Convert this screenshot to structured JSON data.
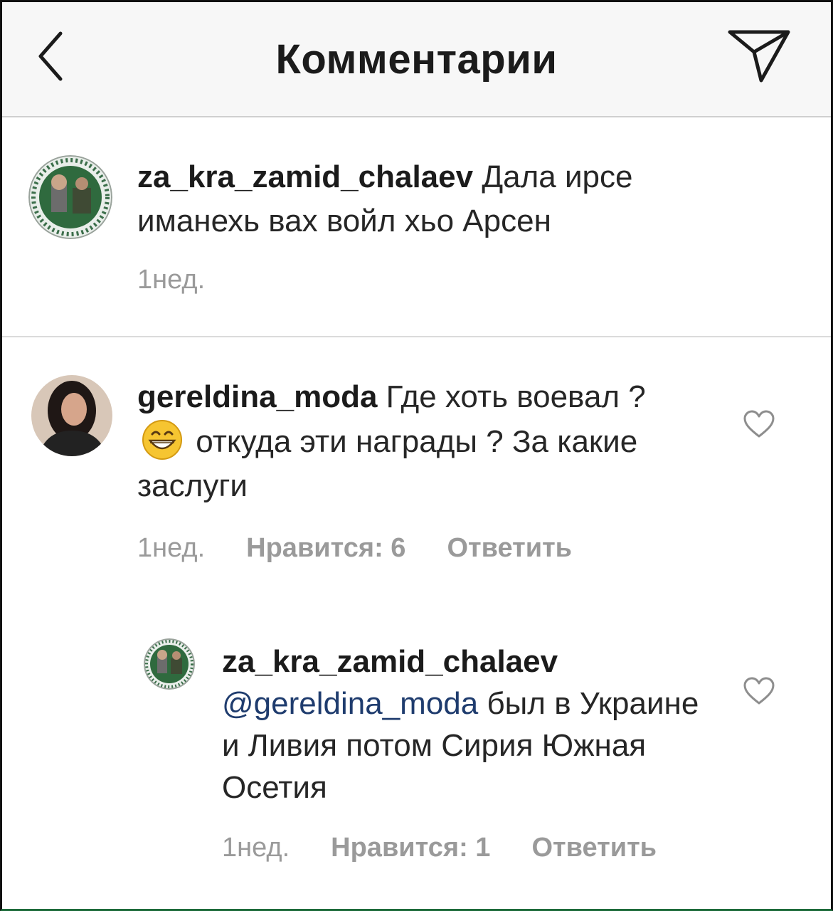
{
  "header": {
    "title": "Комментарии",
    "back_icon": "chevron-left-icon",
    "send_icon": "paper-plane-icon"
  },
  "comments": [
    {
      "username": "za_kra_zamid_chalaev",
      "text": "Дала ирсе иманехь вах войл хьо Арсен",
      "time": "1нед."
    },
    {
      "username": "gereldina_moda",
      "text_before_emoji": "Где хоть воевал ?",
      "emoji": "grinning-face-emoji",
      "text_after_emoji": "откуда эти награды ? За какие заслуги",
      "time": "1нед.",
      "likes_label": "Нравится: 6",
      "reply_label": "Ответить"
    }
  ],
  "reply": {
    "username": "za_kra_zamid_chalaev",
    "mention": "@gereldina_moda",
    "text": "был в Украине и Ливия потом Сирия Южная Осетия",
    "time": "1нед.",
    "likes_label": "Нравится: 1",
    "reply_label": "Ответить"
  },
  "colors": {
    "header_bg": "#f7f7f7",
    "text": "#262626",
    "meta": "#9a9a9a",
    "mention": "#1f3c6e"
  }
}
